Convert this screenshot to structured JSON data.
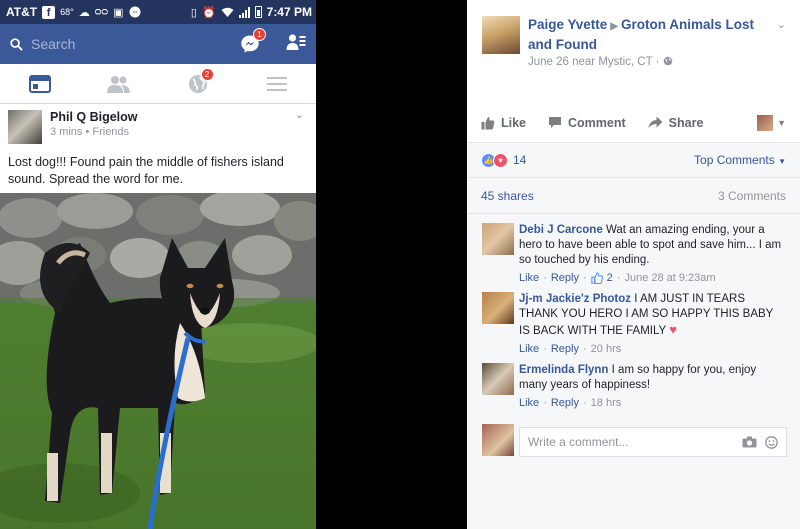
{
  "mobile": {
    "status_bar": {
      "carrier": "AT&T",
      "fb_letter": "f",
      "temperature": "68°",
      "time": "7:47 PM"
    },
    "search": {
      "placeholder": "Search",
      "messenger_badge": "1",
      "brand_color": "#3b5998"
    },
    "tabs": [
      {
        "icon": "news-feed-icon",
        "active": true
      },
      {
        "icon": "friends-icon"
      },
      {
        "icon": "globe-notifications-icon",
        "badge": "2"
      },
      {
        "icon": "menu-icon"
      }
    ],
    "post": {
      "author": "Phil Q Bigelow",
      "meta": "3 mins • Friends",
      "text": "Lost dog!!! Found pain the middle of fishers island sound. Spread the word for me."
    }
  },
  "desktop": {
    "header": {
      "author": "Paige Yvette",
      "arrow": "▶",
      "group": "Groton Animals Lost and Found",
      "date_location": "June 26 near Mystic, CT · "
    },
    "actions": {
      "like": "Like",
      "comment": "Comment",
      "share": "Share"
    },
    "feedback": {
      "reaction_count": "14",
      "top_comments": "Top Comments",
      "shares": "45 shares",
      "comments_count": "3 Comments"
    },
    "comments": [
      {
        "author": "Debi J Carcone",
        "text": "Wat an amazing ending, your a hero to have been able to spot and save him... I am so touched by his ending.",
        "like": "Like",
        "reply": "Reply",
        "likes": "2",
        "time": "June 28 at 9:23am"
      },
      {
        "author": "Jj-m Jackie'z Photoz",
        "text": "I AM JUST IN TEARS THANK YOU HERO I AM SO HAPPY THIS BABY IS BACK WITH THE FAMILY",
        "like": "Like",
        "reply": "Reply",
        "time": "20 hrs"
      },
      {
        "author": "Ermelinda Flynn",
        "text": "I am so happy for you, enjoy many years of happiness!",
        "like": "Like",
        "reply": "Reply",
        "time": "18 hrs"
      }
    ],
    "write_comment": {
      "placeholder": "Write a comment..."
    },
    "link_color": "#365899"
  }
}
